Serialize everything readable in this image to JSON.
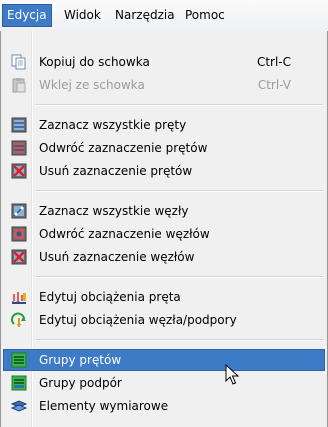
{
  "menubar": {
    "tabs": [
      {
        "label": "Edycja",
        "active": true
      },
      {
        "label": "Widok",
        "active": false
      },
      {
        "label": "Narzędzia",
        "active": false
      },
      {
        "label": "Pomoc",
        "active": false
      }
    ]
  },
  "menu": {
    "items": [
      {
        "label": "Kopiuj do schowka",
        "shortcut": "Ctrl-C",
        "icon": "copy-icon"
      },
      {
        "label": "Wklej ze schowka",
        "shortcut": "Ctrl-V",
        "icon": "paste-icon",
        "disabled": true
      },
      {
        "label": "Zaznacz wszystkie pręty",
        "icon": "select-all-bars-icon"
      },
      {
        "label": "Odwróć zaznaczenie prętów",
        "icon": "invert-bars-icon"
      },
      {
        "label": "Usuń zaznaczenie prętów",
        "icon": "clear-bars-icon"
      },
      {
        "label": "Zaznacz wszystkie węzły",
        "icon": "select-all-nodes-icon"
      },
      {
        "label": "Odwróć zaznaczenie węzłów",
        "icon": "invert-nodes-icon"
      },
      {
        "label": "Usuń zaznaczenie węzłów",
        "icon": "clear-nodes-icon"
      },
      {
        "label": "Edytuj obciążenia pręta",
        "icon": "bar-load-icon"
      },
      {
        "label": "Edytuj obciążenia węzła/podpory",
        "icon": "node-load-icon"
      },
      {
        "label": "Grupy prętów",
        "icon": "bar-groups-icon",
        "highlighted": true
      },
      {
        "label": "Grupy podpór",
        "icon": "support-groups-icon"
      },
      {
        "label": "Elementy wymiarowe",
        "icon": "dimension-elements-icon"
      }
    ]
  },
  "colors": {
    "highlight": "#3d7bc7",
    "menu_bg": "#f0f0f0",
    "disabled_text": "#9b9b9b"
  }
}
